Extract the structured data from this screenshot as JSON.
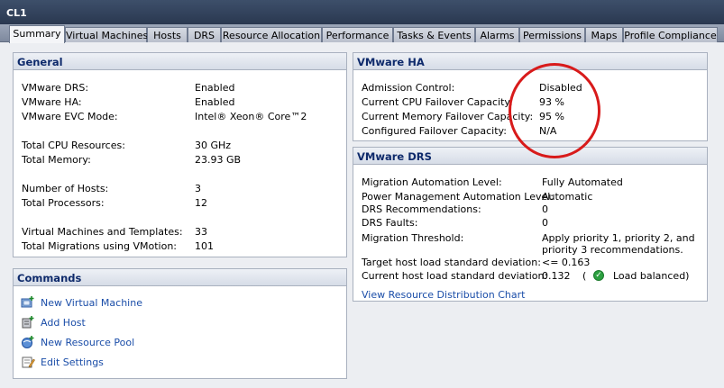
{
  "window": {
    "title": "CL1"
  },
  "tabs": [
    {
      "label": "Summary",
      "active": true
    },
    {
      "label": "Virtual Machines"
    },
    {
      "label": "Hosts"
    },
    {
      "label": "DRS"
    },
    {
      "label": "Resource Allocation"
    },
    {
      "label": "Performance"
    },
    {
      "label": "Tasks & Events"
    },
    {
      "label": "Alarms"
    },
    {
      "label": "Permissions"
    },
    {
      "label": "Maps"
    },
    {
      "label": "Profile Compliance"
    }
  ],
  "general": {
    "header": "General",
    "rows": [
      {
        "label": "VMware DRS:",
        "value": "Enabled"
      },
      {
        "label": "VMware HA:",
        "value": "Enabled"
      },
      {
        "label": "VMware EVC Mode:",
        "value": "Intel® Xeon® Core™2"
      },
      {
        "label": "Total CPU Resources:",
        "value": "30 GHz"
      },
      {
        "label": "Total Memory:",
        "value": "23.93 GB"
      },
      {
        "label": "Number of Hosts:",
        "value": "3"
      },
      {
        "label": "Total Processors:",
        "value": "12"
      },
      {
        "label": "Virtual Machines and Templates:",
        "value": "33"
      },
      {
        "label": "Total Migrations using VMotion:",
        "value": "101"
      }
    ]
  },
  "commands": {
    "header": "Commands",
    "items": [
      {
        "label": "New Virtual Machine",
        "icon": "new-vm-icon"
      },
      {
        "label": "Add Host",
        "icon": "add-host-icon"
      },
      {
        "label": "New Resource Pool",
        "icon": "resource-pool-icon"
      },
      {
        "label": "Edit Settings",
        "icon": "edit-settings-icon"
      }
    ]
  },
  "ha": {
    "header": "VMware HA",
    "rows": [
      {
        "label": "Admission Control:",
        "value": "Disabled"
      },
      {
        "label": "Current CPU Failover Capacity:",
        "value": "93 %"
      },
      {
        "label": "Current Memory Failover Capacity:",
        "value": "95 %"
      },
      {
        "label": "Configured Failover Capacity:",
        "value": "N/A"
      }
    ]
  },
  "drs": {
    "header": "VMware DRS",
    "rows": [
      {
        "label": "Migration Automation Level:",
        "value": "Fully Automated"
      },
      {
        "label": "Power Management Automation Level:",
        "value": "Automatic"
      },
      {
        "label": "DRS Recommendations:",
        "value": "0"
      },
      {
        "label": "DRS Faults:",
        "value": "0"
      },
      {
        "label": "Migration Threshold:",
        "value": "Apply priority 1, priority 2, and",
        "value2": "priority 3 recommendations."
      },
      {
        "label": "Target host load standard deviation:",
        "value": "<= 0.163"
      },
      {
        "label": "Current host load standard deviation:",
        "value": "0.132",
        "paren_open": "(",
        "status": "Load balanced)"
      }
    ],
    "link": "View Resource Distribution Chart"
  }
}
